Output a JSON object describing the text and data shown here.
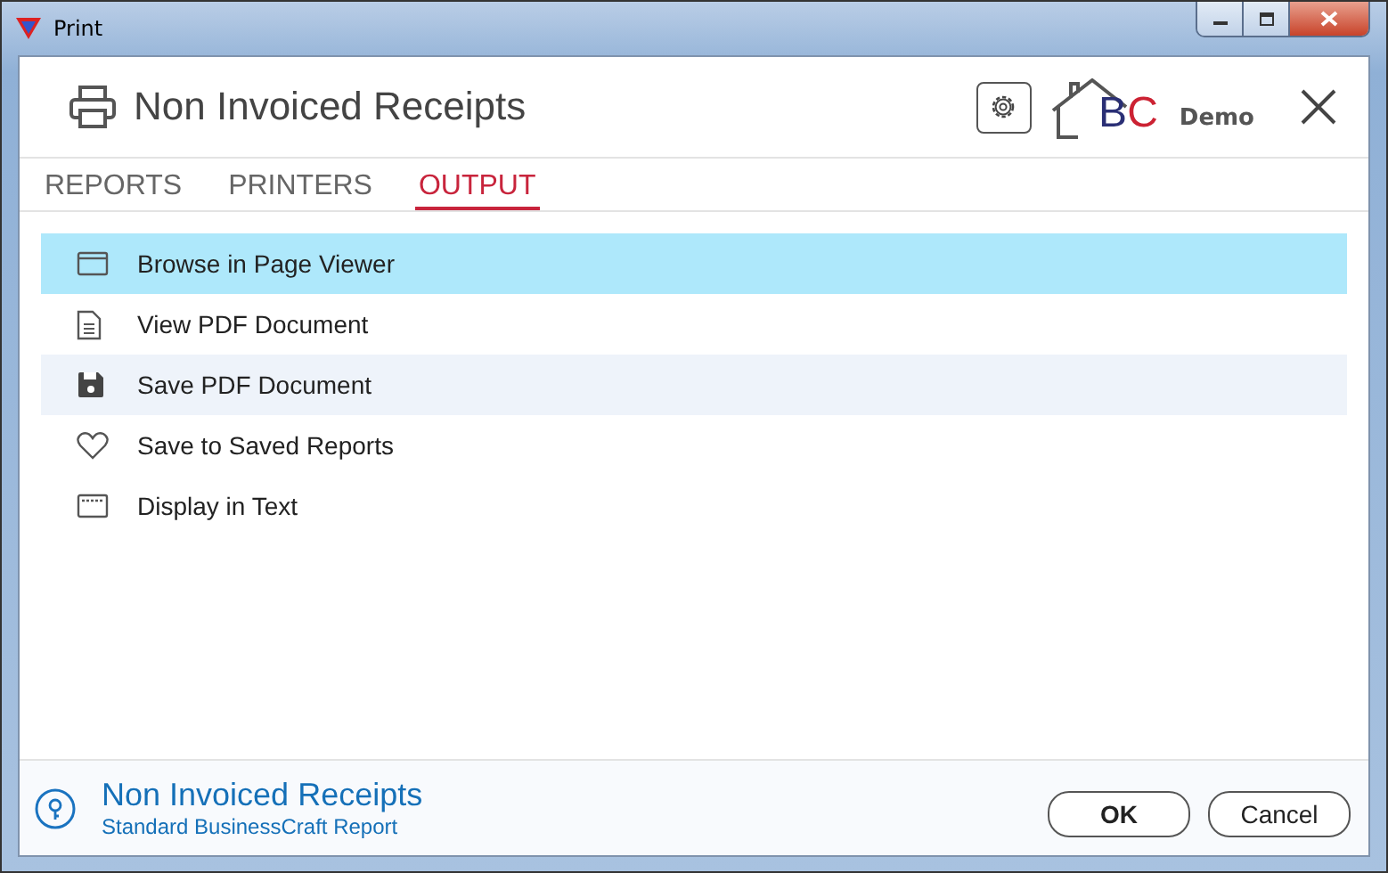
{
  "window": {
    "title": "Print"
  },
  "header": {
    "title": "Non Invoiced Receipts",
    "logo": {
      "first": "B",
      "second": "C",
      "label": "Demo"
    }
  },
  "tabs": [
    {
      "label": "REPORTS",
      "selected": false
    },
    {
      "label": "PRINTERS",
      "selected": false
    },
    {
      "label": "OUTPUT",
      "selected": true
    }
  ],
  "options": [
    {
      "label": "Browse in Page Viewer",
      "kind": "window",
      "selected": true,
      "hovered": false
    },
    {
      "label": "View PDF Document",
      "kind": "document",
      "selected": false,
      "hovered": false
    },
    {
      "label": "Save PDF Document",
      "kind": "save",
      "selected": false,
      "hovered": true
    },
    {
      "label": "Save to Saved Reports",
      "kind": "heart",
      "selected": false,
      "hovered": false
    },
    {
      "label": "Display in Text",
      "kind": "text",
      "selected": false,
      "hovered": false
    }
  ],
  "footer": {
    "title": "Non Invoiced Receipts",
    "subtitle": "Standard BusinessCraft Report"
  },
  "buttons": [
    "OK",
    "Cancel"
  ]
}
